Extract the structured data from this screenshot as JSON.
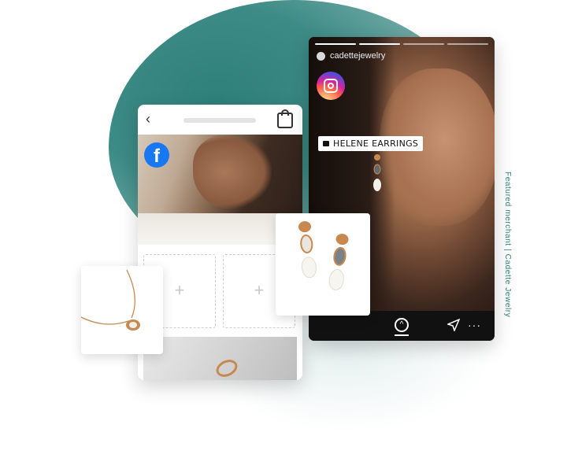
{
  "instagram": {
    "username": "cadettejewelry",
    "product_tag": "HELENE EARRINGS",
    "progress_segments": [
      true,
      true,
      false,
      false
    ]
  },
  "facebook": {
    "back_icon": "‹",
    "add_slot_symbol": "+"
  },
  "caption": "Featured merchant | Cadette Jewelry",
  "icons": [
    "facebook-logo-icon",
    "instagram-logo-icon",
    "shopping-bag-icon",
    "back-arrow-icon",
    "swipe-up-icon",
    "send-icon",
    "more-icon"
  ],
  "colors": {
    "teal": "#2f7f7a",
    "facebook_blue": "#1877f2",
    "gold": "#c7894f"
  }
}
